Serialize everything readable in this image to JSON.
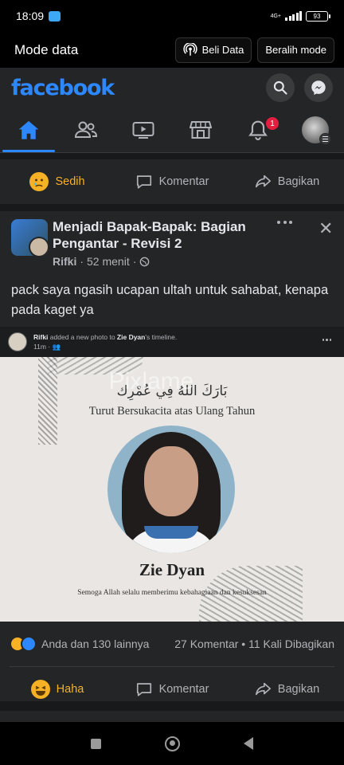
{
  "status_bar": {
    "time": "18:09",
    "network": "4G+",
    "battery": "93"
  },
  "data_mode_bar": {
    "title": "Mode data",
    "buy_data_label": "Beli Data",
    "switch_mode_label": "Beralih mode"
  },
  "header": {
    "logo_text": "facebook",
    "accent_color": "#2d88ff"
  },
  "tabs": {
    "items": [
      {
        "icon": "home-icon",
        "active": true
      },
      {
        "icon": "friends-icon",
        "active": false
      },
      {
        "icon": "watch-icon",
        "active": false
      },
      {
        "icon": "marketplace-icon",
        "active": false
      },
      {
        "icon": "bell-icon",
        "active": false
      },
      {
        "icon": "profile-menu-icon",
        "active": false
      }
    ],
    "notification_count": "1"
  },
  "top_action_bar": {
    "reaction_label": "Sedih",
    "comment_label": "Komentar",
    "share_label": "Bagikan"
  },
  "post": {
    "group_name": "Menjadi Bapak-Bapak: Bagian Pengantar - Revisi 2",
    "author": "Rifki",
    "time": "52 menit",
    "caption": "pack saya ngasih ucapan ultah untuk sahabat, kenapa pada kaget ya",
    "shared": {
      "author": "Rifki",
      "middle_text": " added a new photo to ",
      "target": "Zie Dyan",
      "suffix": "'s timeline.",
      "time": "11m"
    },
    "image": {
      "arabic_text": "بَارَكَ اللهُ فِي عُمْرِك",
      "title": "Turut Bersukacita atas Ulang Tahun",
      "name": "Zie Dyan",
      "prayer": "Semoga Allah selalu memberimu kebahagiaan dan kesuksesan",
      "watermark": "Pixlame"
    },
    "stats": {
      "reactions": "Anda dan 130 lainnya",
      "comments_shares": "27 Komentar • 11 Kali Dibagikan"
    },
    "actions": {
      "reaction_label": "Haha",
      "comment_label": "Komentar",
      "share_label": "Bagikan"
    }
  }
}
